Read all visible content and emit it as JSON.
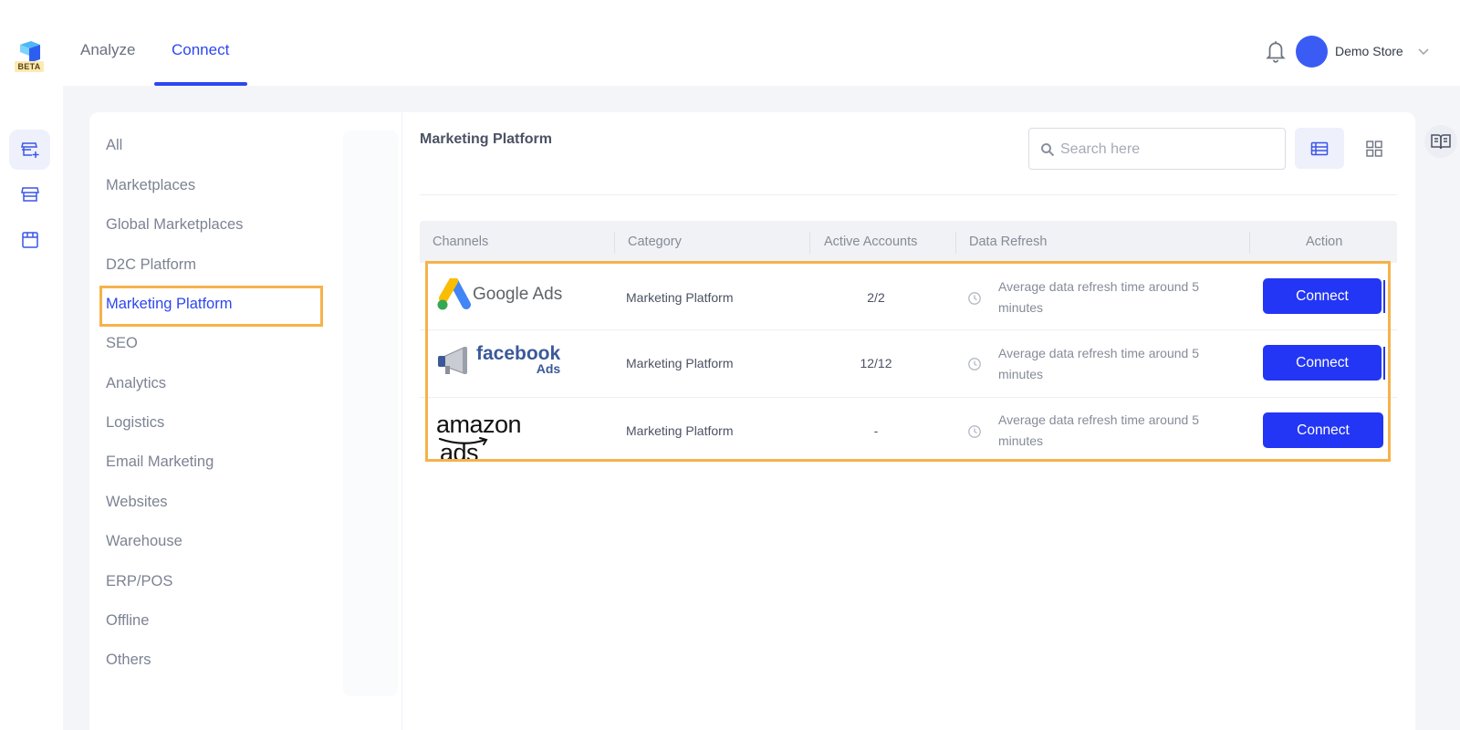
{
  "app": {
    "beta_badge": "BETA",
    "nav_tabs": [
      {
        "label": "Analyze",
        "active": false
      },
      {
        "label": "Connect",
        "active": true
      }
    ],
    "store_name": "Demo Store",
    "accent_color": "#2d47f0"
  },
  "rail": {
    "items": [
      {
        "icon": "store-add-icon",
        "active": true
      },
      {
        "icon": "storefront-icon",
        "active": false
      },
      {
        "icon": "shop-icon",
        "active": false
      }
    ]
  },
  "categories": [
    "All",
    "Marketplaces",
    "Global Marketplaces",
    "D2C Platform",
    "Marketing Platform",
    "SEO",
    "Analytics",
    "Logistics",
    "Email Marketing",
    "Websites",
    "Warehouse",
    "ERP/POS",
    "Offline",
    "Others"
  ],
  "selected_category": "Marketing Platform",
  "main": {
    "title": "Marketing Platform",
    "search_placeholder": "Search here",
    "view_mode": "list",
    "table": {
      "headers": [
        "Channels",
        "Category",
        "Active Accounts",
        "Data Refresh",
        "Action"
      ],
      "rows": [
        {
          "channel_logo": "Google Ads",
          "category": "Marketing Platform",
          "active_accounts": "2/2",
          "refresh": "Average data refresh time around 5 minutes",
          "action": "Connect"
        },
        {
          "channel_logo_main": "facebook",
          "channel_logo_sub": "Ads",
          "category": "Marketing Platform",
          "active_accounts": "12/12",
          "refresh": "Average data refresh time around 5 minutes",
          "action": "Connect"
        },
        {
          "channel_logo_main": "amazon",
          "channel_logo_sub": "ads",
          "category": "Marketing Platform",
          "active_accounts": "-",
          "refresh": "Average data refresh time around 5 minutes",
          "action": "Connect"
        }
      ]
    }
  },
  "highlight_color": "#f5b24a"
}
